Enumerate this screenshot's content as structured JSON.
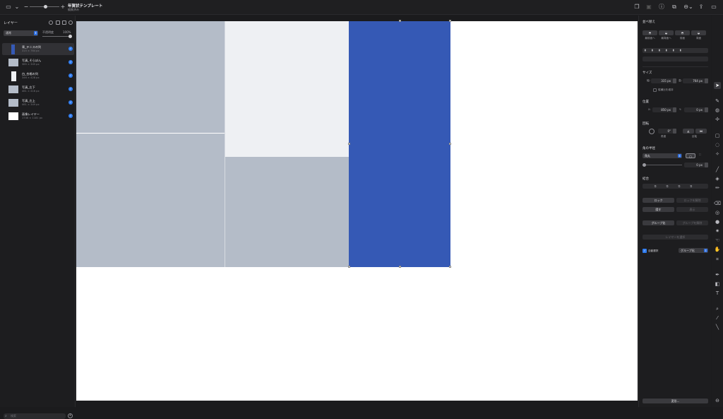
{
  "window": {
    "title": "年賀状テンプレート",
    "subtitle": "編集済み"
  },
  "layers_panel": {
    "title": "レイヤー",
    "blend_mode": "通常",
    "opacity_label": "不透明度",
    "opacity_value": "100%",
    "layers": [
      {
        "name": "青_テニスの列",
        "size": "315 × 764 px",
        "thumb_color": "#3559b5",
        "selected": true
      },
      {
        "name": "写真_そらぼん",
        "size": "385 × 345 px",
        "thumb_color": "#b4bcc8",
        "selected": false
      },
      {
        "name": "白_合格の列",
        "size": "346 × 428 px",
        "thumb_color": "#eef0f3",
        "selected": false
      },
      {
        "name": "写真_左下",
        "size": "461 × 416 px",
        "thumb_color": "#b4bcc8",
        "selected": false
      },
      {
        "name": "写真_左上",
        "size": "461 × 349 px",
        "thumb_color": "#b4bcc8",
        "selected": false
      },
      {
        "name": "画像レイヤー",
        "size": "1748 × 1181 px",
        "thumb_color": "#ffffff",
        "selected": false
      }
    ],
    "search_placeholder": "検索"
  },
  "inspector": {
    "arrange_title": "並べ替え",
    "arrange_buttons": [
      "最前面へ",
      "最背面へ",
      "前面",
      "背面"
    ],
    "size_title": "サイズ",
    "width_label": "幅:",
    "width_value": "315 px",
    "height_label": "高:",
    "height_value": "764 px",
    "keep_ratio_label": "縦横比を維持",
    "position_title": "位置",
    "x_label": "X:",
    "x_value": "850 px",
    "y_label": "Y:",
    "y_value": "0 px",
    "rotate_title": "回転",
    "angle_value": "0°",
    "angle_label": "角度",
    "flip_label": "反転",
    "corner_title": "角の半径",
    "corner_mode": "角丸",
    "corner_value": "0 px",
    "combine_title": "結合",
    "lock_label": "ロック",
    "unlock_label": "ロックを解除",
    "hide_label": "隠す",
    "show_label": "表示",
    "group_label": "グループ化",
    "ungroup_label": "グループを解除",
    "select_layer_label": "レイヤーを選択",
    "auto_select_label": "自動選択",
    "auto_select_mode": "グループ化",
    "transform_button": "変形..."
  },
  "colors": {
    "accent": "#2f7cf0",
    "blue_column": "#3559b5",
    "photo_gray": "#b4bcc8",
    "light_panel": "#eef0f3"
  }
}
